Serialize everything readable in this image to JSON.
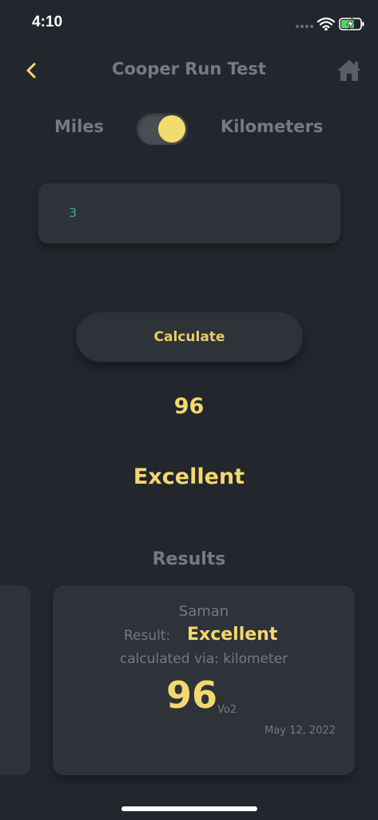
{
  "status": {
    "time": "4:10"
  },
  "nav": {
    "title": "Cooper Run Test",
    "back_icon": "chevron-left-icon",
    "home_icon": "home-icon"
  },
  "units": {
    "left_label": "Miles",
    "right_label": "Kilometers",
    "toggle_selected": "Kilometers"
  },
  "input": {
    "value": "3"
  },
  "calculate": {
    "label": "Calculate"
  },
  "output": {
    "score": "96",
    "rating": "Excellent"
  },
  "results": {
    "heading": "Results",
    "card": {
      "name": "Saman",
      "result_label": "Result:",
      "result_value": "Excellent",
      "method": "calculated via: kilometer",
      "score": "96",
      "unit": "Vo2",
      "date": "May 12, 2022"
    }
  },
  "colors": {
    "background": "#23262d",
    "card": "#2e3239",
    "accent": "#f3d86d",
    "muted": "#777a7f",
    "input_text": "#3aa89a"
  }
}
